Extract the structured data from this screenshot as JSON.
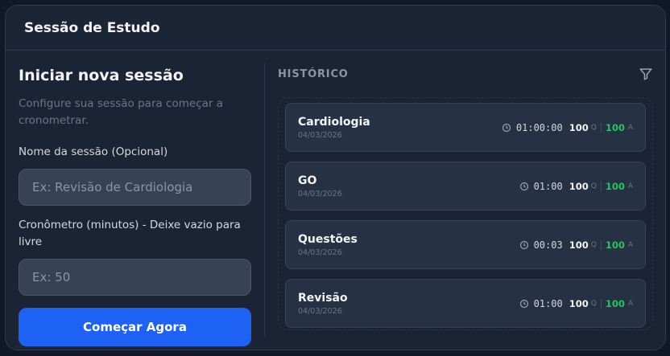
{
  "header": {
    "title": "Sessão de Estudo"
  },
  "form": {
    "title": "Iniciar nova sessão",
    "subtitle": "Configure sua sessão para começar a cronometrar.",
    "name_label": "Nome da sessão (Opcional)",
    "name_placeholder": "Ex: Revisão de Cardiologia",
    "name_value": "",
    "timer_label": "Cronômetro (minutos) - Deixe vazio para livre",
    "timer_placeholder": "Ex: 50",
    "timer_value": "",
    "start_label": "Começar Agora"
  },
  "history": {
    "title": "HISTÓRICO",
    "filter_icon": "filter-icon",
    "items": [
      {
        "name": "Cardiologia",
        "date": "04/03/2026",
        "time": "01:00:00",
        "questions": "100",
        "q_unit": "Q",
        "answers": "100",
        "a_unit": "A"
      },
      {
        "name": "GO",
        "date": "04/03/2026",
        "time": "01:00",
        "questions": "100",
        "q_unit": "Q",
        "answers": "100",
        "a_unit": "A"
      },
      {
        "name": "Questões",
        "date": "04/03/2026",
        "time": "00:03",
        "questions": "100",
        "q_unit": "Q",
        "answers": "100",
        "a_unit": "A"
      },
      {
        "name": "Revisão",
        "date": "04/03/2026",
        "time": "01:00",
        "questions": "100",
        "q_unit": "Q",
        "answers": "100",
        "a_unit": "A"
      }
    ]
  },
  "colors": {
    "accent": "#1e62f5",
    "success": "#22c55e",
    "background": "#1b2434"
  }
}
